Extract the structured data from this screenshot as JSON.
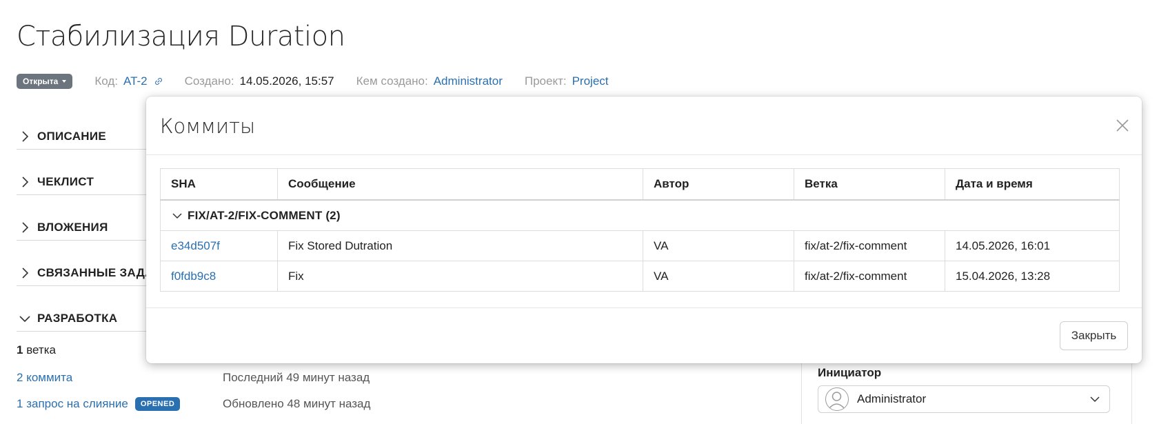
{
  "page": {
    "title": "Стабилизация Duration",
    "status": "Открыта",
    "meta": {
      "code_label": "Код:",
      "code_value": "AT-2",
      "created_label": "Создано:",
      "created_value": "14.05.2026, 15:57",
      "creator_label": "Кем создано:",
      "creator_value": "Administrator",
      "project_label": "Проект:",
      "project_value": "Project"
    },
    "sections": [
      {
        "label": "ОПИСАНИЕ",
        "expanded": false
      },
      {
        "label": "ЧЕКЛИСТ",
        "expanded": false
      },
      {
        "label": "ВЛОЖЕНИЯ",
        "expanded": false
      },
      {
        "label": "СВЯЗАННЫЕ ЗАДА",
        "expanded": false
      },
      {
        "label": "РАЗРАБОТКА",
        "expanded": true
      }
    ],
    "development": {
      "branches_count": "1",
      "branches_label": "ветка",
      "commits_count": "2",
      "commits_label": "коммита",
      "commits_note": "Последний 49 минут назад",
      "mr_count": "1",
      "mr_label": "запрос на слияние",
      "mr_badge": "OPENED",
      "mr_note": "Обновлено 48 минут назад"
    },
    "side": {
      "initiator_label": "Инициатор",
      "initiator_value": "Administrator"
    }
  },
  "modal": {
    "title": "Коммиты",
    "columns": [
      "SHA",
      "Сообщение",
      "Автор",
      "Ветка",
      "Дата и время"
    ],
    "group": "FIX/AT-2/FIX-COMMENT (2)",
    "rows": [
      {
        "sha": "e34d507f",
        "message": "Fix Stored Dutration",
        "author": "VA",
        "branch": "fix/at-2/fix-comment",
        "datetime": "14.05.2026, 16:01"
      },
      {
        "sha": "f0fdb9c8",
        "message": "Fix",
        "author": "VA",
        "branch": "fix/at-2/fix-comment",
        "datetime": "15.04.2026, 13:28"
      }
    ],
    "close_button": "Закрыть"
  },
  "icons": {
    "status_caret": "caret-down-icon",
    "code_link": "link-icon",
    "section_collapsed": "chevron-right-icon",
    "section_expanded": "chevron-down-icon",
    "modal_close": "close-icon",
    "select": "chevron-down-icon",
    "avatar": "user-avatar-icon"
  },
  "colors": {
    "link": "#2a6fb0",
    "status_pill": "#6c757d",
    "badge": "#2a6fb0"
  }
}
